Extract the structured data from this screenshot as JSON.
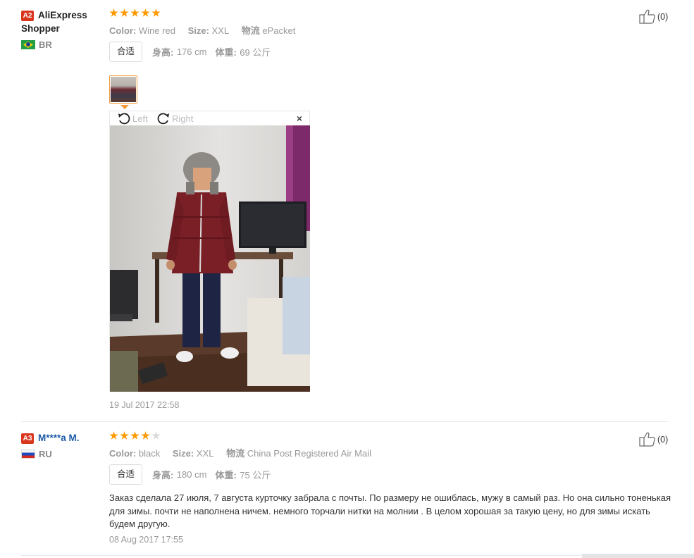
{
  "reviews": [
    {
      "level": "A2",
      "username": "AliExpress Shopper",
      "country": "BR",
      "stars": 5,
      "color_label": "Color:",
      "color_value": "Wine red",
      "size_label": "Size:",
      "size_value": "XXL",
      "shipping_label": "物流",
      "shipping_value": "ePacket",
      "fit": "合适",
      "height_label": "身高:",
      "height_value": "176 cm",
      "weight_label": "体重:",
      "weight_value": "69 公斤",
      "rotate_left": "Left",
      "rotate_right": "Right",
      "close": "×",
      "date": "19 Jul 2017 22:58",
      "useful": "(0)"
    },
    {
      "level": "A3",
      "username": "M****a M.",
      "country": "RU",
      "stars": 4,
      "color_label": "Color:",
      "color_value": "black",
      "size_label": "Size:",
      "size_value": "XXL",
      "shipping_label": "物流",
      "shipping_value": "China Post Registered Air Mail",
      "fit": "合适",
      "height_label": "身高:",
      "height_value": "180 cm",
      "weight_label": "体重:",
      "weight_value": "75 公斤",
      "comment": "Заказ сделала 27 июля, 7 августа курточку забрала с почты. По размеру не ошиблась, мужу в самый раз. Но она сильно тоненькая для зимы. почти не наполнена ничем. немного торчали нитки на молнии . В целом хорошая за такую цену, но для зимы искать будем другую.",
      "date": "08 Aug 2017 17:55",
      "useful": "(0)"
    }
  ],
  "colors": {
    "star": "#ff9900",
    "level_badge": "#d9361e",
    "thumb_border": "#f09b38"
  }
}
